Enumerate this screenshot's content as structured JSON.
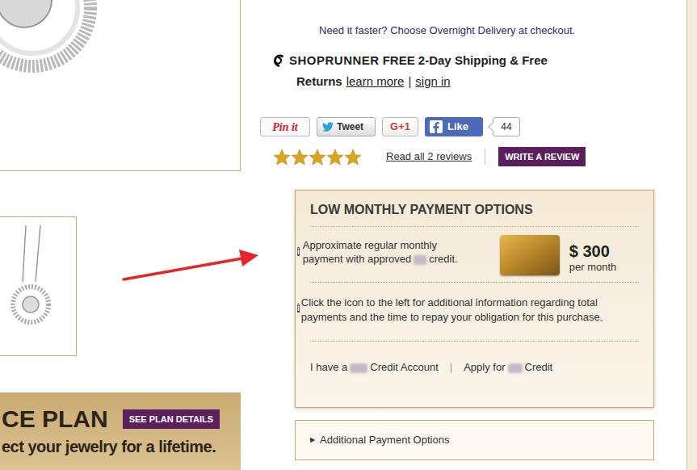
{
  "delivery_note": "Need it faster? Choose Overnight Delivery at checkout.",
  "shoprunner": {
    "brand": "SHOPRUNNER",
    "headline": "FREE 2-Day Shipping & Free",
    "returns": "Returns",
    "learn_more": "learn more",
    "separator": "|",
    "sign_in": "sign in"
  },
  "social": [
    {
      "kind": "pinterest",
      "label": "Pin it"
    },
    {
      "kind": "twitter",
      "label": "Tweet"
    },
    {
      "kind": "google",
      "label": "G+1"
    },
    {
      "kind": "facebook",
      "label": "Like"
    },
    {
      "kind": "count",
      "label": "44"
    }
  ],
  "reviews": {
    "stars": 5,
    "read_all": "Read all 2 reviews",
    "write": "WRITE A REVIEW"
  },
  "payment": {
    "title": "LOW MONTHLY PAYMENT OPTIONS",
    "estimate": {
      "icon": "i",
      "line1": "Approximate regular monthly",
      "line2": "payment with approved",
      "line2_end": "credit.",
      "amount": "$ 300",
      "period": "per month"
    },
    "info": {
      "icon": "i",
      "text": "Click the icon to the left for additional information regarding total payments and the time to repay your obligation for this purchase."
    },
    "links": {
      "have_prefix": "I have a",
      "have_suffix": "Credit Account",
      "separator": "|",
      "apply_prefix": "Apply for",
      "apply_suffix": "Credit"
    }
  },
  "additional": {
    "arrow": "▶",
    "label": "Additional Payment Options"
  },
  "banner": {
    "title": "CE PLAN",
    "button": "SEE PLAN DETAILS",
    "tagline": "ect your jewelry for a lifetime."
  }
}
